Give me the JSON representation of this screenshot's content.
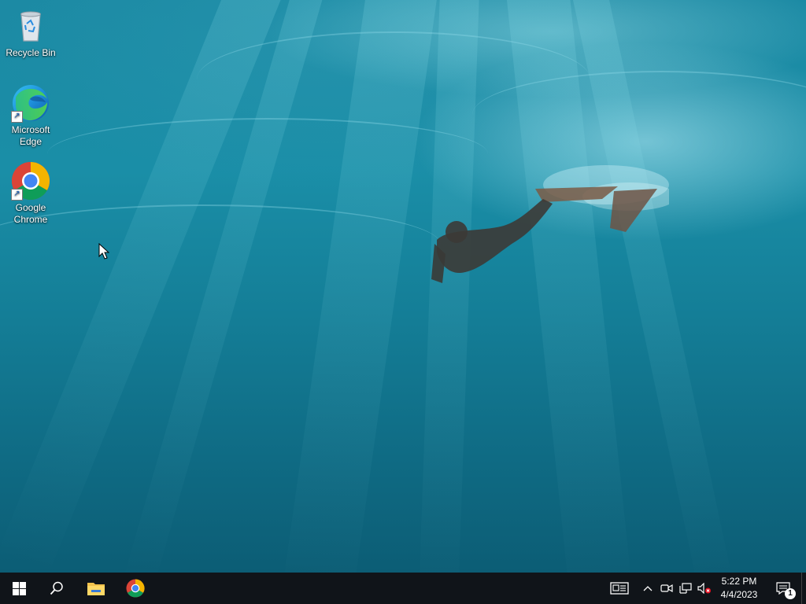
{
  "desktop": {
    "icons": [
      {
        "label": "Recycle Bin",
        "icon": "recycle-bin-icon"
      },
      {
        "label": "Microsoft Edge",
        "icon": "edge-icon"
      },
      {
        "label": "Google Chrome",
        "icon": "chrome-icon"
      }
    ],
    "wallpaper": "underwater-freediver"
  },
  "taskbar": {
    "start": {
      "icon": "windows-logo-icon"
    },
    "search": {
      "icon": "search-icon"
    },
    "pinned": [
      {
        "icon": "file-explorer-icon"
      },
      {
        "icon": "chrome-icon"
      }
    ],
    "tray": {
      "news_icon": "news-widget-icon",
      "overflow_icon": "chevron-up-icon",
      "meet_icon": "meet-now-icon",
      "network_icon": "network-icon",
      "volume_icon": "volume-muted-icon",
      "time": "5:22 PM",
      "date": "4/4/2023",
      "notifications": "1"
    }
  },
  "colors": {
    "taskbar_bg": "#101419",
    "water": "#1a8ea7"
  }
}
